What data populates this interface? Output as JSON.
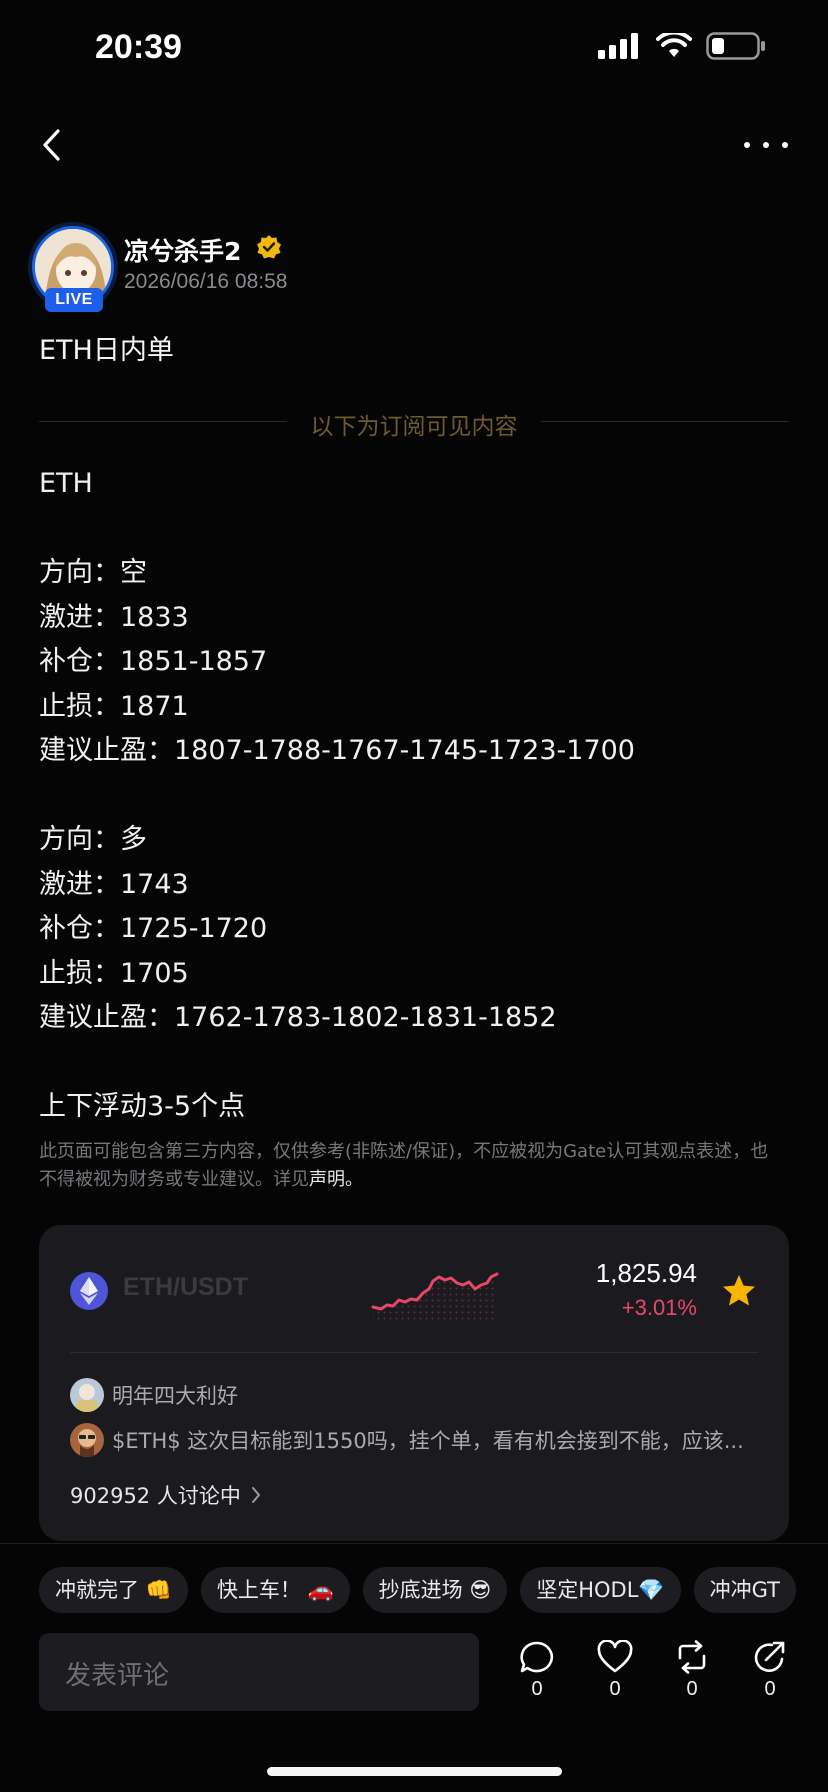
{
  "status_bar": {
    "time": "20:39"
  },
  "author": {
    "name": "凉兮杀手2",
    "live_label": "LIVE",
    "timestamp": "2026/06/16 08:58"
  },
  "post": {
    "title": "ETH日内单",
    "divider_text": "以下为订阅可见内容",
    "lines": [
      "ETH",
      "",
      "方向：空",
      "激进：1833",
      "补仓：1851-1857",
      "止损：1871",
      "建议止盈：1807-1788-1767-1745-1723-1700",
      "",
      "方向：多",
      "激进：1743",
      "补仓：1725-1720",
      "止损：1705",
      "建议止盈：1762-1783-1802-1831-1852",
      "",
      "上下浮动3-5个点"
    ],
    "disclaimer": "此页面可能包含第三方内容，仅供参考(非陈述/保证)，不应被视为Gate认可其观点表述，也不得被视为财务或专业建议。详见",
    "disclaimer_link": "声明。"
  },
  "market_card": {
    "pair": "ETH/USDT",
    "price": "1,825.94",
    "change": "+3.01%",
    "change_color": "#e8466a",
    "discussion_user": "明年四大利好",
    "discussion_text": "$ETH$  这次目标能到1550吗，挂个单，看有机会接到不能，应该...",
    "discussion_count": "902952 人讨论中"
  },
  "chips": [
    "冲就完了 👊",
    "快上车！ 🚗",
    "抄底进场 😎",
    "坚定HODL💎",
    "冲冲GT"
  ],
  "comment": {
    "placeholder": "发表评论"
  },
  "actions": {
    "comment_count": "0",
    "like_count": "0",
    "repost_count": "0",
    "share_count": "0"
  }
}
